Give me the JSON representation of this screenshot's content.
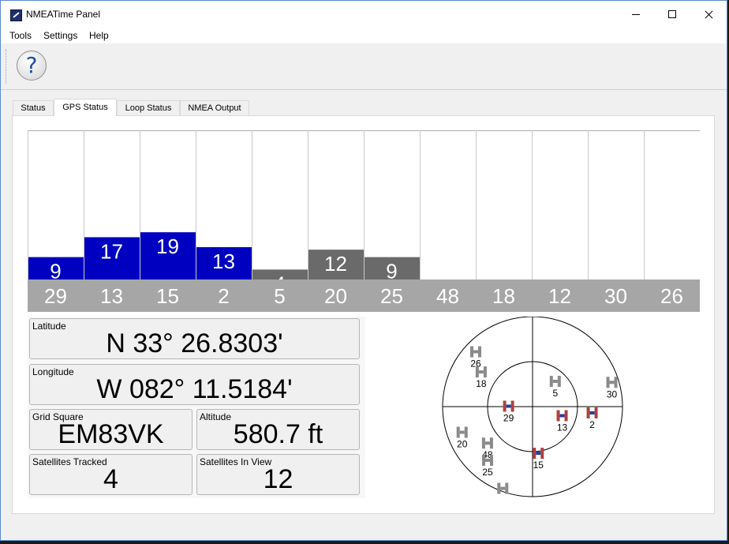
{
  "window": {
    "title": "NMEATime Panel"
  },
  "menu": [
    "Tools",
    "Settings",
    "Help"
  ],
  "toolbar": {
    "help_glyph": "?"
  },
  "tabs": [
    {
      "label": "Status",
      "active": false
    },
    {
      "label": "GPS Status",
      "active": true
    },
    {
      "label": "Loop Status",
      "active": false
    },
    {
      "label": "NMEA Output",
      "active": false
    }
  ],
  "colors": {
    "tracked": "#0000c0",
    "untracked": "#6a6a6a",
    "label_strip": "#a6a6a6",
    "sat_tracked": "#b04040",
    "sat_untracked": "#8a8a8a"
  },
  "chart_data": {
    "type": "bar",
    "categories": [
      "29",
      "13",
      "15",
      "2",
      "5",
      "20",
      "25",
      "48",
      "18",
      "12",
      "30",
      "26"
    ],
    "values": [
      9,
      17,
      19,
      13,
      4,
      12,
      9,
      0,
      0,
      0,
      0,
      0
    ],
    "tracked": [
      true,
      true,
      true,
      true,
      false,
      false,
      false,
      false,
      false,
      false,
      false,
      false
    ],
    "value_labels": [
      "9",
      "17",
      "19",
      "13",
      "4",
      "12",
      "9",
      "",
      "",
      "",
      "",
      ""
    ],
    "ylim": [
      0,
      60
    ]
  },
  "gps": {
    "latitude_label": "Latitude",
    "latitude": "N 33° 26.8303'",
    "longitude_label": "Longitude",
    "longitude": "W 082° 11.5184'",
    "grid_label": "Grid Square",
    "grid": "EM83VK",
    "altitude_label": "Altitude",
    "altitude": "580.7 ft",
    "tracked_label": "Satellites Tracked",
    "tracked": "4",
    "inview_label": "Satellites In View",
    "inview": "12"
  },
  "sky": {
    "satellites": [
      {
        "prn": "26",
        "azimuth": 314,
        "elevation": 11,
        "tracked": false
      },
      {
        "prn": "18",
        "azimuth": 304,
        "elevation": 28,
        "tracked": false
      },
      {
        "prn": "5",
        "azimuth": 42,
        "elevation": 56,
        "tracked": false
      },
      {
        "prn": "30",
        "azimuth": 73,
        "elevation": 7,
        "tracked": false
      },
      {
        "prn": "29",
        "azimuth": 271,
        "elevation": 66,
        "tracked": true
      },
      {
        "prn": "13",
        "azimuth": 107,
        "elevation": 59,
        "tracked": true
      },
      {
        "prn": "2",
        "azimuth": 96,
        "elevation": 30,
        "tracked": true
      },
      {
        "prn": "20",
        "azimuth": 250,
        "elevation": 15,
        "tracked": false
      },
      {
        "prn": "48",
        "azimuth": 231,
        "elevation": 32,
        "tracked": false
      },
      {
        "prn": "15",
        "azimuth": 173,
        "elevation": 43,
        "tracked": true
      },
      {
        "prn": "25",
        "azimuth": 220,
        "elevation": 20,
        "tracked": false
      },
      {
        "prn": "",
        "azimuth": 200,
        "elevation": 3,
        "tracked": false
      }
    ]
  }
}
